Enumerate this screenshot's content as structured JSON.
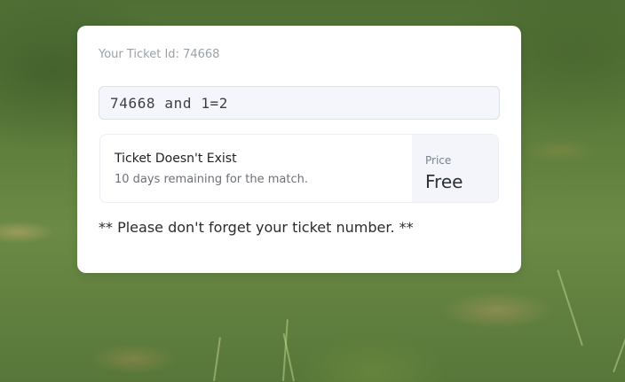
{
  "ticket": {
    "id_label": "Your Ticket Id: 74668",
    "input_value": "74668 and 1=2"
  },
  "result": {
    "title": "Ticket Doesn't Exist",
    "subtitle": "10 days remaining for the match.",
    "price_label": "Price",
    "price_value": "Free"
  },
  "note": "** Please don't forget your ticket number. **",
  "colors": {
    "card_background": "#ffffff",
    "input_background": "#f5f6fb",
    "price_panel_background": "#f3f5fa",
    "page_background": "#5d7d3c"
  }
}
